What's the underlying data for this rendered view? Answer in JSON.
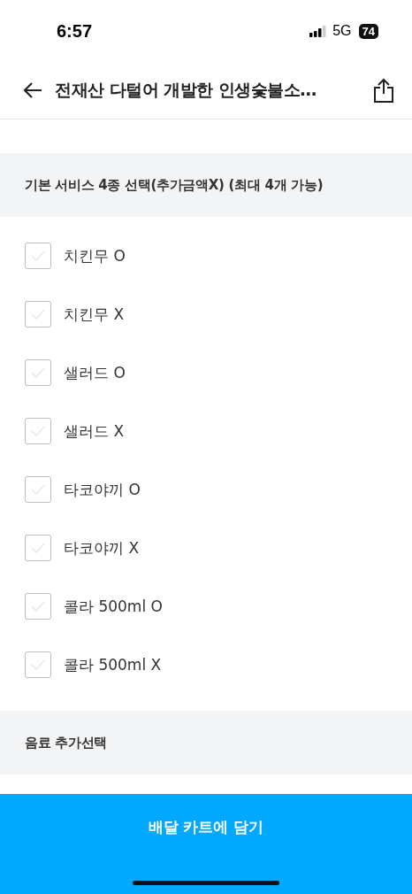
{
  "status_bar": {
    "time": "6:57",
    "network": "5G",
    "battery": "74"
  },
  "nav": {
    "title": "전재산 다털어 개발한 인생숯불소…"
  },
  "sections": [
    {
      "title": "기본 서비스 4종 선택(추가금액X) (최대 4개 가능)",
      "options": [
        {
          "label": "치킨무 O",
          "checked": false
        },
        {
          "label": "치킨무 X",
          "checked": false
        },
        {
          "label": "샐러드 O",
          "checked": false
        },
        {
          "label": "샐러드 X",
          "checked": false
        },
        {
          "label": "타코야끼 O",
          "checked": false
        },
        {
          "label": "타코야끼 X",
          "checked": false
        },
        {
          "label": "콜라 500ml O",
          "checked": false
        },
        {
          "label": "콜라 500ml X",
          "checked": false
        }
      ]
    },
    {
      "title": "음료 추가선택"
    }
  ],
  "cart_button": {
    "label": "배달 카트에 담기"
  }
}
